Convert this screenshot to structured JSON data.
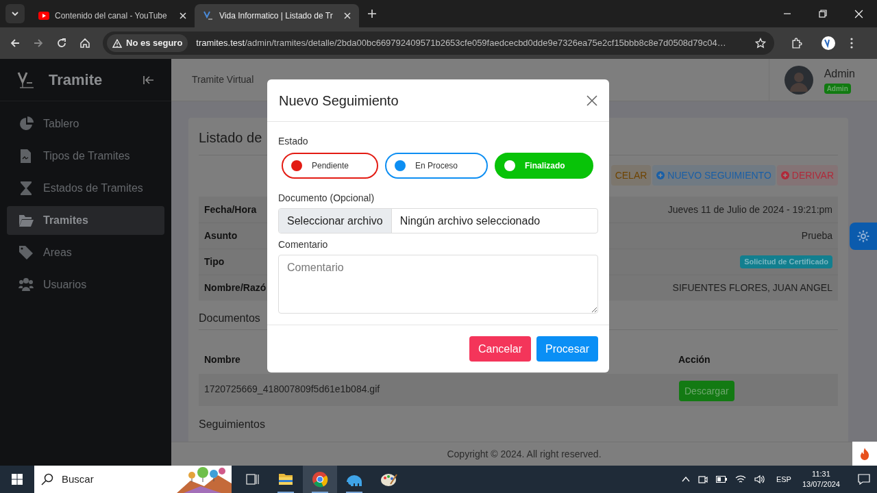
{
  "browser": {
    "tabs": [
      {
        "title": "Contenido del canal - YouTube",
        "selected": false
      },
      {
        "title": "Vida Informatico | Listado de Tr",
        "selected": true
      }
    ],
    "security": "No es seguro",
    "url_host": "tramites.test",
    "url_path": "/admin/tramites/detalle/2bda00bc669792409571b2653cfe059faedcecbd0dde9e7326ea75e2cf15bbb8c8e7d0508d79c04…"
  },
  "sidebar": {
    "brand": "Tramite",
    "items": [
      {
        "label": "Tablero",
        "selected": false
      },
      {
        "label": "Tipos de Tramites",
        "selected": false
      },
      {
        "label": "Estados de Tramites",
        "selected": false
      },
      {
        "label": "Tramites",
        "selected": true
      },
      {
        "label": "Areas",
        "selected": false
      },
      {
        "label": "Usuarios",
        "selected": false
      }
    ]
  },
  "header": {
    "title": "Tramite Virtual",
    "user": "Admin",
    "role": "Admin"
  },
  "card": {
    "title": "Listado de",
    "actions": [
      {
        "label": "CELAR",
        "color": "#6e4300",
        "icon": false
      },
      {
        "label": "NUEVO SEGUIMIENTO",
        "color": "#1a5fa6",
        "icon": true
      },
      {
        "label": "DERIVAR",
        "color": "#b02a3a",
        "icon": true
      }
    ],
    "details": [
      {
        "label": "Fecha/Hora",
        "value": "Jueves 11 de Julio de 2024 - 19:21:pm",
        "kind": "text"
      },
      {
        "label": "Asunto",
        "value": "Prueba",
        "kind": "text"
      },
      {
        "label": "Tipo",
        "value": "Solicitud de Certificado",
        "kind": "badge"
      },
      {
        "label": "Nombre/Razó",
        "value": "SIFUENTES FLORES, JUAN ANGEL",
        "kind": "text"
      }
    ],
    "documents": {
      "title": "Documentos",
      "columns": [
        "Nombre",
        "Acción"
      ],
      "rows": [
        {
          "name": "1720725669_418007809f5d61e1b084.gif",
          "action": "Descargar"
        }
      ]
    },
    "followups_title": "Seguimientos"
  },
  "footer": "Copyright © 2024. All right reserved.",
  "modal": {
    "title": "Nuevo Seguimiento",
    "status_label": "Estado",
    "statuses": [
      {
        "label": "Pendiente",
        "color": "#e31b13",
        "selected": false
      },
      {
        "label": "En Proceso",
        "color": "#0d8ef2",
        "selected": false
      },
      {
        "label": "Finalizado",
        "color": "#08c308",
        "selected": true
      }
    ],
    "file_label": "Documento (Opcional)",
    "file_button": "Seleccionar archivo",
    "file_value": "Ningún archivo seleccionado",
    "comment_label": "Comentario",
    "comment_placeholder": "Comentario",
    "buttons": [
      {
        "label": "Cancelar",
        "color": "#f4355a"
      },
      {
        "label": "Procesar",
        "color": "#0a8ff5"
      }
    ]
  },
  "taskbar": {
    "search_placeholder": "Buscar",
    "language": "ESP",
    "time": "11:31",
    "date": "13/07/2024"
  }
}
